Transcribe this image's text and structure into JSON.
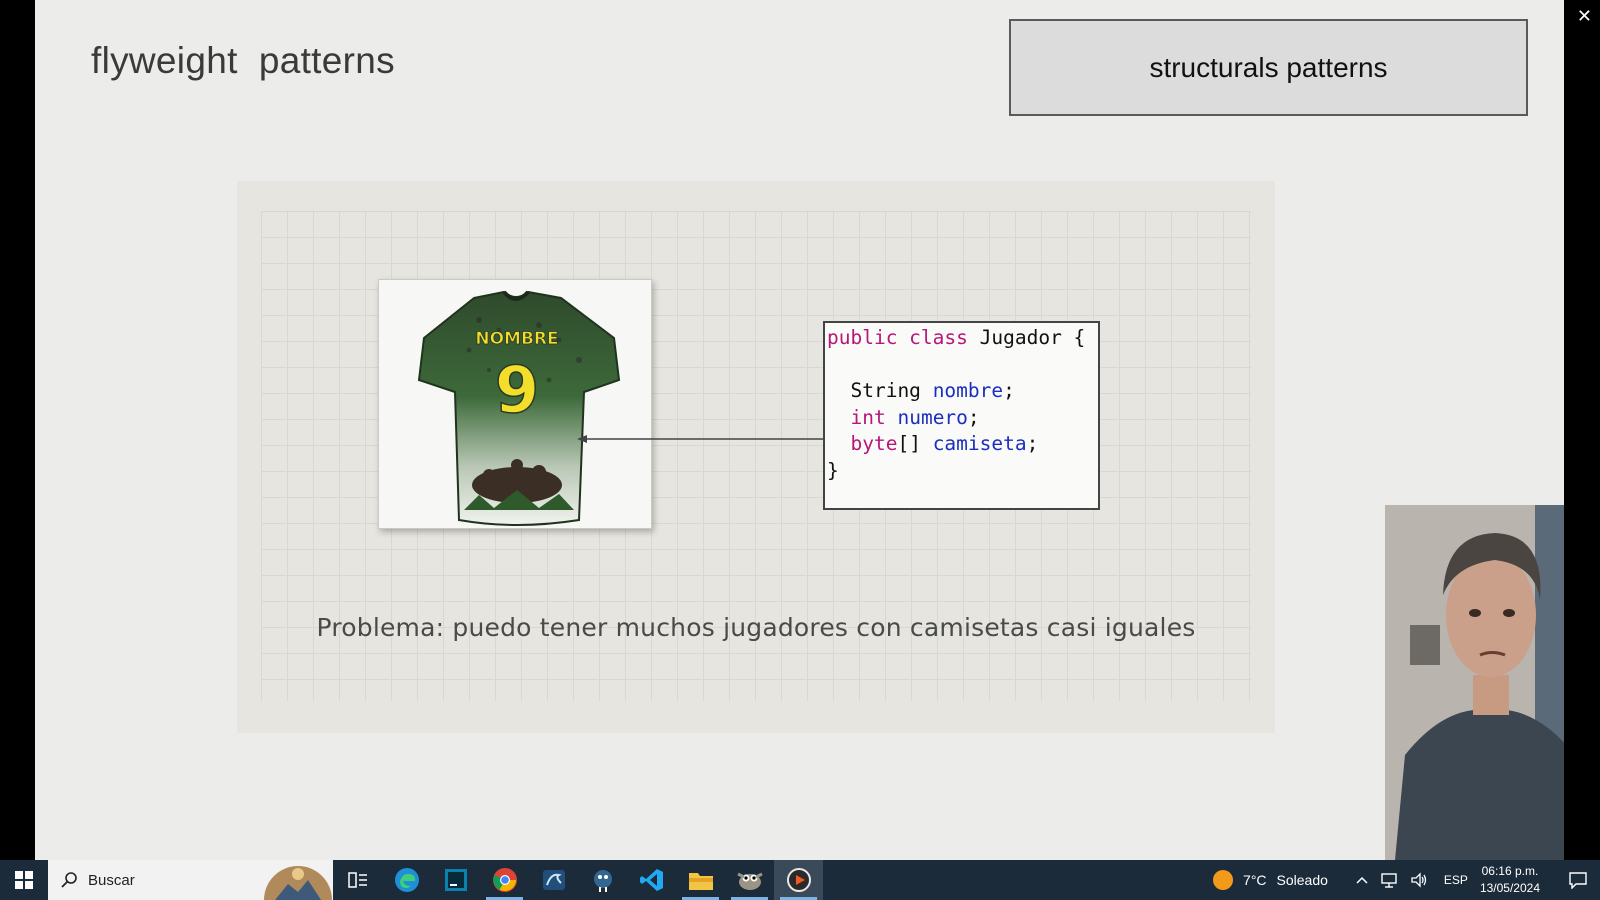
{
  "window": {
    "close_glyph": "✕"
  },
  "slide": {
    "title": "flyweight  patterns",
    "category": "structurals patterns",
    "code": {
      "line1_kw": "public class",
      "line1_name": " Jugador {",
      "line2_type": "String",
      "line2_field": "nombre",
      "line3_type": "int",
      "line3_field": "numero",
      "line4_type": "byte",
      "line4_brackets": "[]",
      "line4_field": "camiseta",
      "semicolon": ";",
      "close_brace": "}"
    },
    "shirt": {
      "name": "NOMBRE",
      "number": "9"
    },
    "problem": "Problema: puedo tener muchos jugadores con camisetas casi iguales"
  },
  "taskbar": {
    "search_placeholder": "Buscar",
    "apps": [
      "search-highlight",
      "task-view",
      "edge",
      "intellij",
      "chrome",
      "mysql-workbench",
      "postgres-pgadmin",
      "vscode",
      "file-explorer",
      "gimp",
      "media-player"
    ],
    "weather": {
      "temp": "7°C",
      "condition": "Soleado"
    },
    "language": "ESP",
    "time": "06:16 p.m.",
    "date": "13/05/2024"
  },
  "colors": {
    "keyword": "#b5177a",
    "identifier": "#1a2fbf",
    "taskbar": "#1c2b3a"
  }
}
